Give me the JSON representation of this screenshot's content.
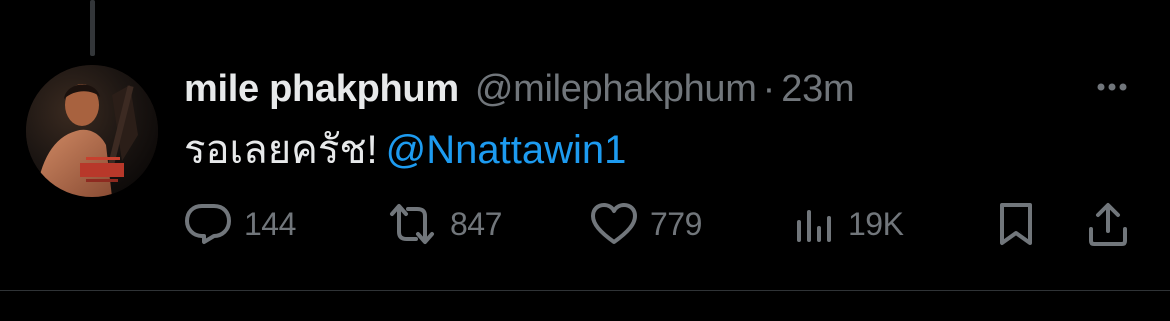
{
  "tweet": {
    "display_name": "mile phakphum",
    "handle": "@milephakphum",
    "separator": "·",
    "timestamp": "23m",
    "text": "รอเลยครัช!",
    "mention": "@Nnattawin1"
  },
  "actions": {
    "replies": "144",
    "retweets": "847",
    "likes": "779",
    "views": "19K"
  },
  "colors": {
    "background": "#000000",
    "primary_text": "#e7e9ea",
    "secondary_text": "#71767b",
    "link": "#1d9bf0"
  },
  "icons": {
    "more": "more-horizontal-icon",
    "reply": "reply-icon",
    "retweet": "retweet-icon",
    "like": "heart-icon",
    "views": "views-bar-chart-icon",
    "bookmark": "bookmark-icon",
    "share": "share-icon"
  }
}
